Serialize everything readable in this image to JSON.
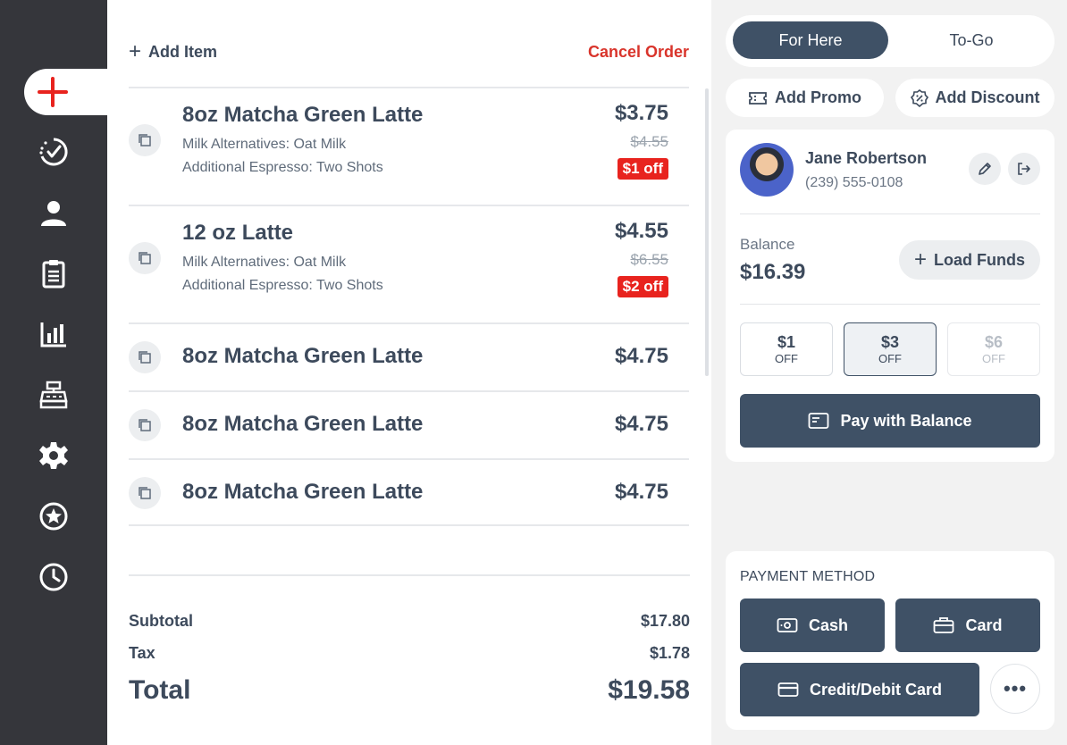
{
  "sidebar": {
    "items": [
      {
        "icon": "new-order-icon",
        "active": true
      },
      {
        "icon": "check-progress-icon"
      },
      {
        "icon": "customer-icon"
      },
      {
        "icon": "clipboard-icon"
      },
      {
        "icon": "bar-chart-icon"
      },
      {
        "icon": "cash-register-icon"
      },
      {
        "icon": "gear-icon"
      },
      {
        "icon": "star-icon"
      },
      {
        "icon": "clock-icon"
      }
    ]
  },
  "order": {
    "add_item_label": "Add Item",
    "cancel_label": "Cancel Order",
    "items": [
      {
        "name": "8oz Matcha Green Latte",
        "price": "$3.75",
        "old_price": "$4.55",
        "badge": "$1 off",
        "mods": [
          "Milk Alternatives: Oat Milk",
          "Additional Espresso: Two Shots"
        ]
      },
      {
        "name": "12 oz Latte",
        "price": "$4.55",
        "old_price": "$6.55",
        "badge": "$2 off",
        "mods": [
          "Milk Alternatives: Oat Milk",
          "Additional Espresso: Two Shots"
        ]
      },
      {
        "name": "8oz Matcha Green Latte",
        "price": "$4.75"
      },
      {
        "name": "8oz Matcha Green Latte",
        "price": "$4.75"
      },
      {
        "name": "8oz Matcha Green Latte",
        "price": "$4.75"
      }
    ]
  },
  "totals": {
    "subtotal_label": "Subtotal",
    "subtotal_value": "$17.80",
    "tax_label": "Tax",
    "tax_value": "$1.78",
    "total_label": "Total",
    "total_value": "$19.58"
  },
  "right": {
    "toggle": {
      "for_here": "For Here",
      "to_go": "To-Go",
      "selected": "For Here"
    },
    "add_promo": "Add Promo",
    "add_discount": "Add Discount",
    "customer": {
      "name": "Jane Robertson",
      "phone": "(239) 555-0108"
    },
    "balance_label": "Balance",
    "balance_value": "$16.39",
    "load_funds": "Load Funds",
    "off_options": [
      {
        "amount": "$1",
        "label": "OFF",
        "state": "normal"
      },
      {
        "amount": "$3",
        "label": "OFF",
        "state": "selected"
      },
      {
        "amount": "$6",
        "label": "OFF",
        "state": "disabled"
      }
    ],
    "pay_with_balance": "Pay with Balance",
    "payment": {
      "title": "PAYMENT METHOD",
      "cash": "Cash",
      "card": "Card",
      "credit_debit": "Credit/Debit Card",
      "more": "•••"
    }
  },
  "colors": {
    "sidebar": "#35363b",
    "accent_red": "#e8231e",
    "primary": "#3f5166",
    "panel_bg": "#f2f2f2"
  }
}
